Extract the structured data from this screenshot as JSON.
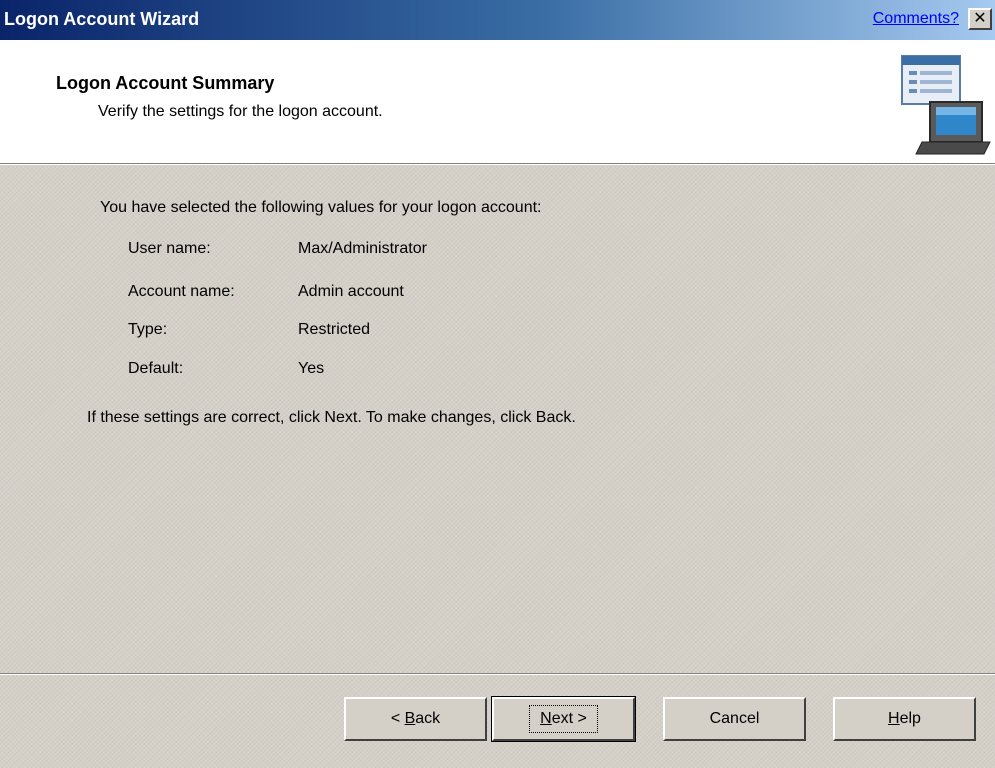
{
  "window": {
    "title": "Logon Account Wizard",
    "comments_link": "Comments?",
    "close_symbol": "✕"
  },
  "header": {
    "title": "Logon Account Summary",
    "subtitle": "Verify the settings for the logon account.",
    "icon": "computer-settings-icon"
  },
  "summary": {
    "intro": "You have selected the following values for your logon account:",
    "rows": [
      {
        "label": "User name:",
        "value": "Max/Administrator"
      },
      {
        "label": "Account name:",
        "value": "Admin account"
      },
      {
        "label": "Type:",
        "value": "Restricted"
      },
      {
        "label": "Default:",
        "value": "Yes"
      }
    ],
    "footer": "If these settings are correct, click Next.  To make changes, click Back."
  },
  "buttons": {
    "back": {
      "lead": "< ",
      "mnemonic": "B",
      "rest": "ack"
    },
    "next": {
      "mnemonic": "N",
      "rest": "ext >"
    },
    "cancel": "Cancel",
    "help": {
      "mnemonic": "H",
      "rest": "elp"
    }
  }
}
